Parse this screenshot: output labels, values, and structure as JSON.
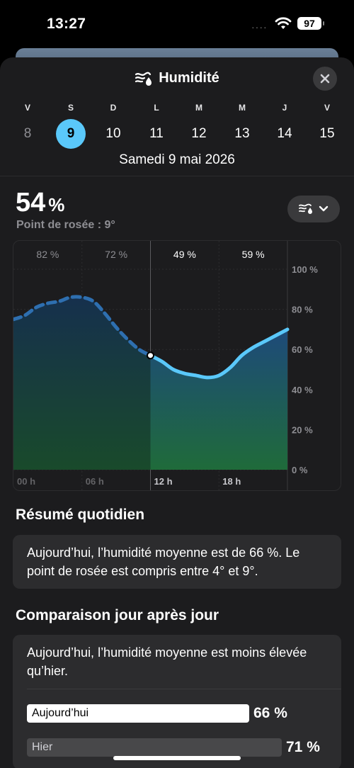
{
  "status_bar": {
    "time": "13:27",
    "battery": "97",
    "signal_dots": "····"
  },
  "header": {
    "title": "Humidité",
    "icon": "humidity-icon"
  },
  "calendar": {
    "day_letters": [
      "V",
      "S",
      "D",
      "L",
      "M",
      "M",
      "J",
      "V"
    ],
    "dates": [
      "8",
      "9",
      "10",
      "11",
      "12",
      "13",
      "14",
      "15"
    ],
    "selected_index": 1,
    "selected_label": "Samedi 9 mai 2026",
    "selected_color": "#5ac8fa"
  },
  "current": {
    "value": "54",
    "unit": "%",
    "dew_point": "Point de rosée : 9°"
  },
  "chart_data": {
    "type": "area",
    "x": [
      0,
      1,
      2,
      3,
      4,
      5,
      6,
      7,
      8,
      9,
      10,
      11,
      12,
      13,
      14,
      15,
      16,
      17,
      18,
      19,
      20,
      21,
      22,
      23,
      24
    ],
    "series": [
      {
        "values": [
          75,
          77,
          81,
          83,
          84,
          86,
          86,
          84,
          78,
          71,
          65,
          60,
          57,
          54,
          50,
          48,
          47,
          46,
          47,
          51,
          57,
          61,
          64,
          67,
          70
        ],
        "past_until": 12
      }
    ],
    "ylim": [
      0,
      100
    ],
    "y_ticks": [
      "100 %",
      "80 %",
      "60 %",
      "40 %",
      "20 %",
      "0 %"
    ],
    "x_ticks": [
      "00 h",
      "06 h",
      "12 h",
      "18 h"
    ],
    "period_labels": [
      "82 %",
      "72 %",
      "49 %",
      "59 %"
    ],
    "grid": true,
    "colors": {
      "line": "#5ac8fa",
      "fill_top": "#1e4a7a",
      "fill_bottom": "#1f6b3a"
    }
  },
  "summary": {
    "title": "Résumé quotidien",
    "text": "Aujourd’hui, l’humidité moyenne est de 66 %. Le point de rosée est compris entre 4° et 9°."
  },
  "comparison": {
    "title": "Comparaison jour après jour",
    "text": "Aujourd’hui, l’humidité moyenne est moins élevée qu’hier.",
    "bars": [
      {
        "label": "Aujourd’hui",
        "value": "66 %",
        "level": 66
      },
      {
        "label": "Hier",
        "value": "71 %",
        "level": 71
      }
    ]
  }
}
